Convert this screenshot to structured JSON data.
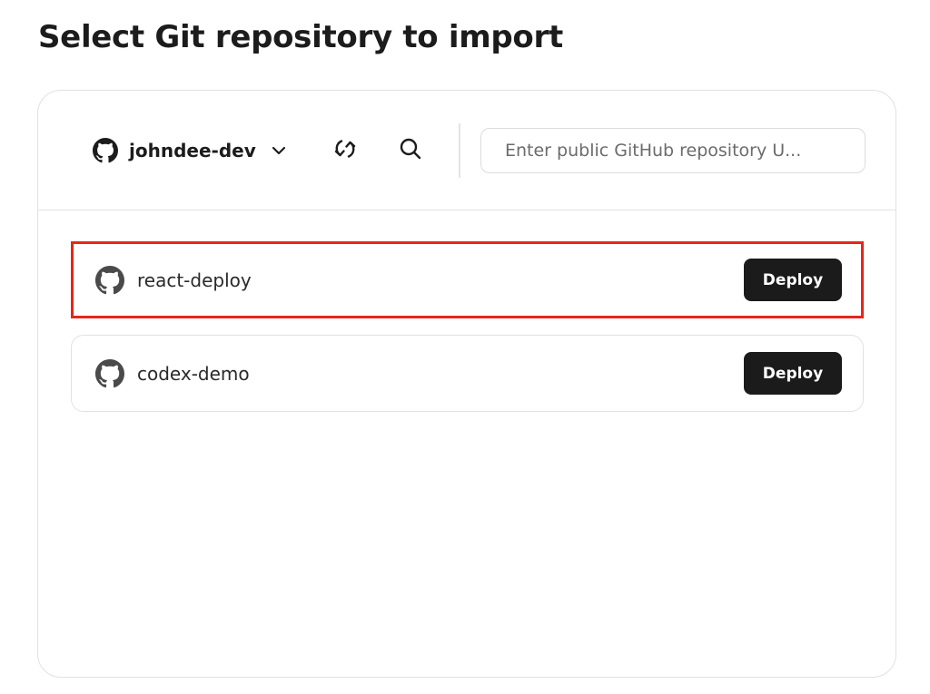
{
  "page": {
    "title": "Select Git repository to import"
  },
  "toolbar": {
    "account_name": "johndee-dev",
    "url_placeholder": "Enter public GitHub repository U..."
  },
  "repositories": [
    {
      "name": "react-deploy",
      "action_label": "Deploy",
      "highlighted": true
    },
    {
      "name": "codex-demo",
      "action_label": "Deploy",
      "highlighted": false
    }
  ],
  "icons": {
    "account": "github-icon",
    "account_dropdown": "chevron-down-icon",
    "refresh": "refresh-icon",
    "search": "search-icon",
    "repo": "github-icon"
  },
  "colors": {
    "highlight_border": "#e8251a",
    "button_bg": "#1b1b1b",
    "button_text": "#ffffff"
  }
}
